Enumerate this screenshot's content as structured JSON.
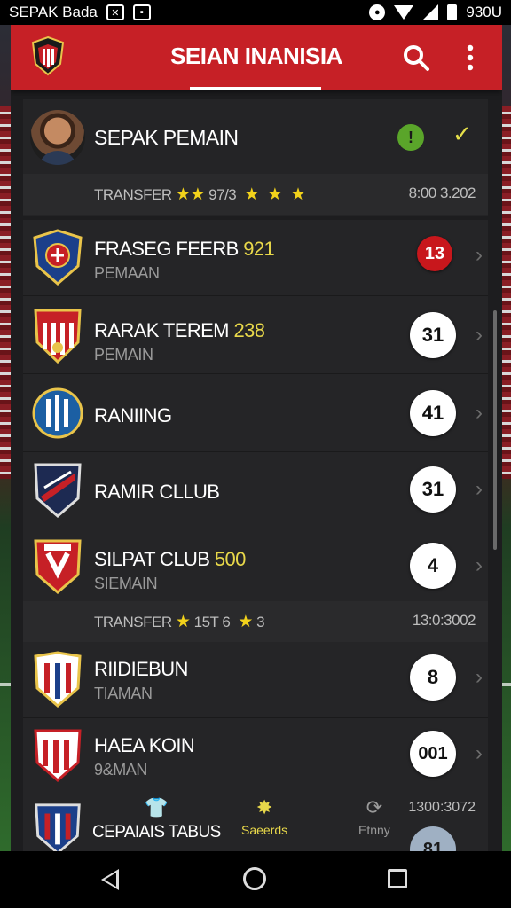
{
  "status_bar": {
    "app_name": "SEPAK Bada",
    "time": "930U"
  },
  "header": {
    "title": "SEIAN INANISIA"
  },
  "player": {
    "name": "SEPAK PEMAIN",
    "info_badge": "!"
  },
  "transfer_1": {
    "label": "TRANSFER",
    "value": "97/3",
    "time": "8:00 3.202"
  },
  "teams": [
    {
      "name": "FRASEG FEERB",
      "number": "921",
      "sub": "PEMAAN",
      "badge": "13"
    },
    {
      "name": "RARAK TEREM",
      "number": "238",
      "sub": "PEMAIN",
      "badge": "31"
    },
    {
      "name": "RANIING",
      "number": "",
      "sub": "",
      "badge": "41"
    },
    {
      "name": "RAMIR CLLUB",
      "number": "",
      "sub": "",
      "badge": "31"
    },
    {
      "name": "SILPAT CLUB",
      "number": "500",
      "sub": "SIEMAIN",
      "badge": "4"
    }
  ],
  "transfer_2": {
    "label": "TRANSFER",
    "value": "15T 6",
    "value2": "3",
    "time": "13:0:3002"
  },
  "teams_2": [
    {
      "name": "RIIDIEBUN",
      "sub": "TIAMAN",
      "badge": "8"
    },
    {
      "name": "HAEA KOIN",
      "sub": "9&MAN",
      "badge": "001"
    }
  ],
  "bottom_tabs": {
    "teams_label": "CEPAIAIS TABUS",
    "search_label": "Saeerds",
    "entry_label": "Etnny",
    "time": "1300:3072",
    "badge": "81"
  },
  "colors": {
    "header_red": "#c62026",
    "accent_yellow": "#e8d84a",
    "star_yellow": "#f2d21b"
  }
}
